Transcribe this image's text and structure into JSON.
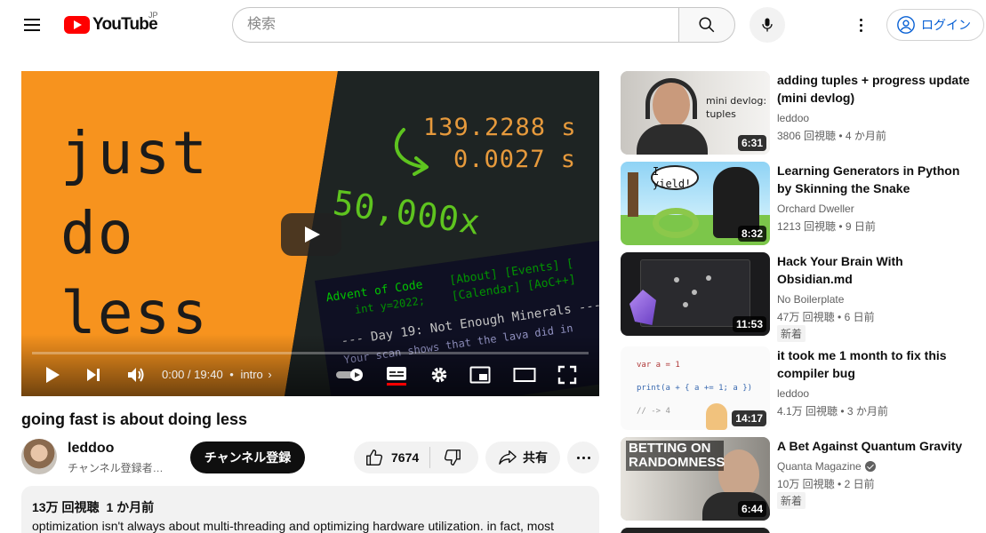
{
  "header": {
    "logo_text": "YouTube",
    "logo_country": "JP",
    "search_placeholder": "検索",
    "login_label": "ログイン"
  },
  "player": {
    "thumb_words": [
      "just",
      "do",
      "less"
    ],
    "time_before": "139.2288 s",
    "time_after": "0.0027 s",
    "speedup": "50,000x",
    "aoc_title": "Advent of Code",
    "aoc_year": "int y=2022;",
    "aoc_menu_1": "[About] [Events] [",
    "aoc_menu_2": "[Calendar] [AoC++]",
    "aoc_day": "--- Day 19: Not Enough Minerals ---",
    "aoc_line": "Your scan shows that the lava did in",
    "time_display": "0:00 / 19:40",
    "chapter": "intro",
    "progress_fraction": 0.0
  },
  "video": {
    "title": "going fast is about doing less",
    "channel": "leddoo",
    "subscribers": "チャンネル登録者…",
    "subscribe_label": "チャンネル登録",
    "likes": "7674",
    "share_label": "共有",
    "views": "13万 回視聴",
    "published": "1 か月前",
    "description": "optimization isn't always about multi-threading and optimizing hardware utilization. in fact, most"
  },
  "recommendations": [
    {
      "title": "adding tuples + progress update (mini devlog)",
      "channel": "leddoo",
      "verified": false,
      "views": "3806 回視聴",
      "age": "4 か月前",
      "duration": "6:31",
      "badge": "",
      "thumb_text": "mini devlog: tuples"
    },
    {
      "title": "Learning Generators in Python by Skinning the Snake",
      "channel": "Orchard Dweller",
      "verified": false,
      "views": "1213 回視聴",
      "age": "9 日前",
      "duration": "8:32",
      "badge": "",
      "thumb_text": "I yield!"
    },
    {
      "title": "Hack Your Brain With Obsidian.md",
      "channel": "No Boilerplate",
      "verified": false,
      "views": "47万 回視聴",
      "age": "6 日前",
      "duration": "11:53",
      "badge": "新着",
      "thumb_text": ""
    },
    {
      "title": "it took me 1 month to fix this compiler bug",
      "channel": "leddoo",
      "verified": false,
      "views": "4.1万 回視聴",
      "age": "3 か月前",
      "duration": "14:17",
      "badge": "",
      "thumb_text": ""
    },
    {
      "title": "A Bet Against Quantum Gravity",
      "channel": "Quanta Magazine",
      "verified": true,
      "views": "10万 回視聴",
      "age": "2 日前",
      "duration": "6:44",
      "badge": "新着",
      "thumb_text": "BETTING ON RANDOMNESS"
    }
  ],
  "colors": {
    "brand": "#ff0000",
    "link": "#065fd4",
    "orange": "#f7931e",
    "green_text": "#5ec41f"
  }
}
